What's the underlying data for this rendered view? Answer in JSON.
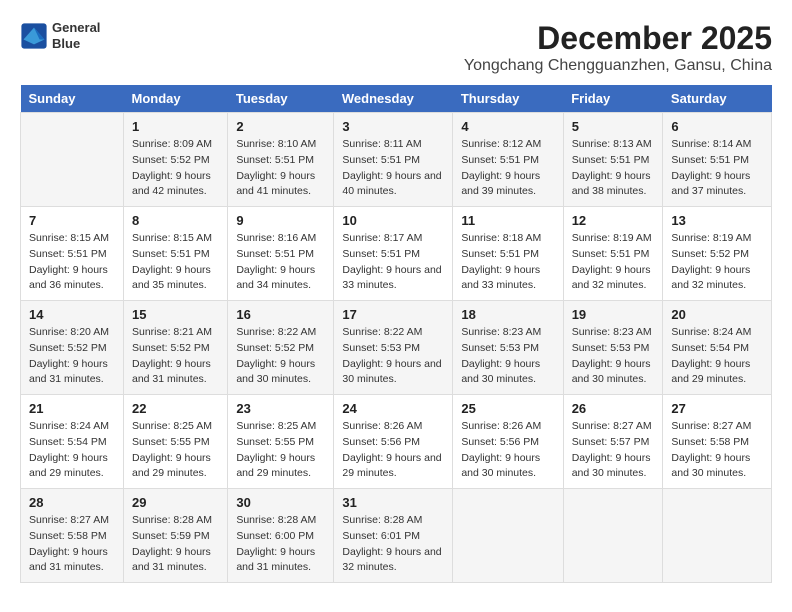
{
  "logo": {
    "line1": "General",
    "line2": "Blue"
  },
  "title": "December 2025",
  "subtitle": "Yongchang Chengguanzhen, Gansu, China",
  "headers": [
    "Sunday",
    "Monday",
    "Tuesday",
    "Wednesday",
    "Thursday",
    "Friday",
    "Saturday"
  ],
  "weeks": [
    [
      {
        "day": "",
        "sunrise": "",
        "sunset": "",
        "daylight": ""
      },
      {
        "day": "1",
        "sunrise": "Sunrise: 8:09 AM",
        "sunset": "Sunset: 5:52 PM",
        "daylight": "Daylight: 9 hours and 42 minutes."
      },
      {
        "day": "2",
        "sunrise": "Sunrise: 8:10 AM",
        "sunset": "Sunset: 5:51 PM",
        "daylight": "Daylight: 9 hours and 41 minutes."
      },
      {
        "day": "3",
        "sunrise": "Sunrise: 8:11 AM",
        "sunset": "Sunset: 5:51 PM",
        "daylight": "Daylight: 9 hours and 40 minutes."
      },
      {
        "day": "4",
        "sunrise": "Sunrise: 8:12 AM",
        "sunset": "Sunset: 5:51 PM",
        "daylight": "Daylight: 9 hours and 39 minutes."
      },
      {
        "day": "5",
        "sunrise": "Sunrise: 8:13 AM",
        "sunset": "Sunset: 5:51 PM",
        "daylight": "Daylight: 9 hours and 38 minutes."
      },
      {
        "day": "6",
        "sunrise": "Sunrise: 8:14 AM",
        "sunset": "Sunset: 5:51 PM",
        "daylight": "Daylight: 9 hours and 37 minutes."
      }
    ],
    [
      {
        "day": "7",
        "sunrise": "Sunrise: 8:15 AM",
        "sunset": "Sunset: 5:51 PM",
        "daylight": "Daylight: 9 hours and 36 minutes."
      },
      {
        "day": "8",
        "sunrise": "Sunrise: 8:15 AM",
        "sunset": "Sunset: 5:51 PM",
        "daylight": "Daylight: 9 hours and 35 minutes."
      },
      {
        "day": "9",
        "sunrise": "Sunrise: 8:16 AM",
        "sunset": "Sunset: 5:51 PM",
        "daylight": "Daylight: 9 hours and 34 minutes."
      },
      {
        "day": "10",
        "sunrise": "Sunrise: 8:17 AM",
        "sunset": "Sunset: 5:51 PM",
        "daylight": "Daylight: 9 hours and 33 minutes."
      },
      {
        "day": "11",
        "sunrise": "Sunrise: 8:18 AM",
        "sunset": "Sunset: 5:51 PM",
        "daylight": "Daylight: 9 hours and 33 minutes."
      },
      {
        "day": "12",
        "sunrise": "Sunrise: 8:19 AM",
        "sunset": "Sunset: 5:51 PM",
        "daylight": "Daylight: 9 hours and 32 minutes."
      },
      {
        "day": "13",
        "sunrise": "Sunrise: 8:19 AM",
        "sunset": "Sunset: 5:52 PM",
        "daylight": "Daylight: 9 hours and 32 minutes."
      }
    ],
    [
      {
        "day": "14",
        "sunrise": "Sunrise: 8:20 AM",
        "sunset": "Sunset: 5:52 PM",
        "daylight": "Daylight: 9 hours and 31 minutes."
      },
      {
        "day": "15",
        "sunrise": "Sunrise: 8:21 AM",
        "sunset": "Sunset: 5:52 PM",
        "daylight": "Daylight: 9 hours and 31 minutes."
      },
      {
        "day": "16",
        "sunrise": "Sunrise: 8:22 AM",
        "sunset": "Sunset: 5:52 PM",
        "daylight": "Daylight: 9 hours and 30 minutes."
      },
      {
        "day": "17",
        "sunrise": "Sunrise: 8:22 AM",
        "sunset": "Sunset: 5:53 PM",
        "daylight": "Daylight: 9 hours and 30 minutes."
      },
      {
        "day": "18",
        "sunrise": "Sunrise: 8:23 AM",
        "sunset": "Sunset: 5:53 PM",
        "daylight": "Daylight: 9 hours and 30 minutes."
      },
      {
        "day": "19",
        "sunrise": "Sunrise: 8:23 AM",
        "sunset": "Sunset: 5:53 PM",
        "daylight": "Daylight: 9 hours and 30 minutes."
      },
      {
        "day": "20",
        "sunrise": "Sunrise: 8:24 AM",
        "sunset": "Sunset: 5:54 PM",
        "daylight": "Daylight: 9 hours and 29 minutes."
      }
    ],
    [
      {
        "day": "21",
        "sunrise": "Sunrise: 8:24 AM",
        "sunset": "Sunset: 5:54 PM",
        "daylight": "Daylight: 9 hours and 29 minutes."
      },
      {
        "day": "22",
        "sunrise": "Sunrise: 8:25 AM",
        "sunset": "Sunset: 5:55 PM",
        "daylight": "Daylight: 9 hours and 29 minutes."
      },
      {
        "day": "23",
        "sunrise": "Sunrise: 8:25 AM",
        "sunset": "Sunset: 5:55 PM",
        "daylight": "Daylight: 9 hours and 29 minutes."
      },
      {
        "day": "24",
        "sunrise": "Sunrise: 8:26 AM",
        "sunset": "Sunset: 5:56 PM",
        "daylight": "Daylight: 9 hours and 29 minutes."
      },
      {
        "day": "25",
        "sunrise": "Sunrise: 8:26 AM",
        "sunset": "Sunset: 5:56 PM",
        "daylight": "Daylight: 9 hours and 30 minutes."
      },
      {
        "day": "26",
        "sunrise": "Sunrise: 8:27 AM",
        "sunset": "Sunset: 5:57 PM",
        "daylight": "Daylight: 9 hours and 30 minutes."
      },
      {
        "day": "27",
        "sunrise": "Sunrise: 8:27 AM",
        "sunset": "Sunset: 5:58 PM",
        "daylight": "Daylight: 9 hours and 30 minutes."
      }
    ],
    [
      {
        "day": "28",
        "sunrise": "Sunrise: 8:27 AM",
        "sunset": "Sunset: 5:58 PM",
        "daylight": "Daylight: 9 hours and 31 minutes."
      },
      {
        "day": "29",
        "sunrise": "Sunrise: 8:28 AM",
        "sunset": "Sunset: 5:59 PM",
        "daylight": "Daylight: 9 hours and 31 minutes."
      },
      {
        "day": "30",
        "sunrise": "Sunrise: 8:28 AM",
        "sunset": "Sunset: 6:00 PM",
        "daylight": "Daylight: 9 hours and 31 minutes."
      },
      {
        "day": "31",
        "sunrise": "Sunrise: 8:28 AM",
        "sunset": "Sunset: 6:01 PM",
        "daylight": "Daylight: 9 hours and 32 minutes."
      },
      {
        "day": "",
        "sunrise": "",
        "sunset": "",
        "daylight": ""
      },
      {
        "day": "",
        "sunrise": "",
        "sunset": "",
        "daylight": ""
      },
      {
        "day": "",
        "sunrise": "",
        "sunset": "",
        "daylight": ""
      }
    ]
  ]
}
